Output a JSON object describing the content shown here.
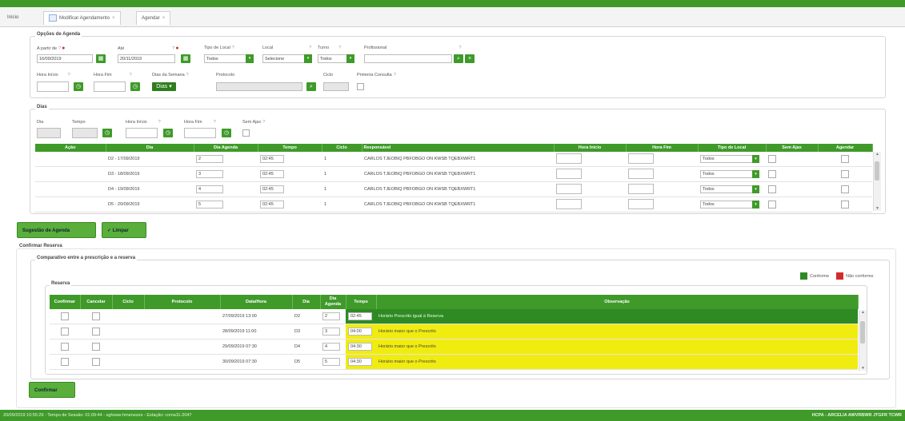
{
  "tabs": [
    {
      "label": "Início"
    },
    {
      "label": "Modificar Agendamento"
    },
    {
      "label": "Agendar"
    }
  ],
  "opcoes": {
    "legend": "Opções de Agenda",
    "a_partir_de": {
      "label": "A partir de",
      "value": "16/09/2019"
    },
    "ate": {
      "label": "Até",
      "value": "20/11/2019"
    },
    "tipo_local": {
      "label": "Tipo de Local",
      "value": "Todos"
    },
    "local": {
      "label": "Local",
      "value": "Selecione"
    },
    "turno": {
      "label": "Turno",
      "value": "Todos"
    },
    "profissional": {
      "label": "Profissional",
      "value": ""
    },
    "hora_inicio": {
      "label": "Hora Início"
    },
    "hora_fim": {
      "label": "Hora Fim"
    },
    "dias_semana": {
      "label": "Dias da Semana",
      "btn": "Dias"
    },
    "protocolo": {
      "label": "Protocolo"
    },
    "ciclo": {
      "label": "Ciclo"
    },
    "primeira_consulta": {
      "label": "Primeira Consulta"
    }
  },
  "dias": {
    "legend": "Dias",
    "labels": {
      "dia": "Dia",
      "tempo": "Tempo",
      "hora_inicio": "Hora Início",
      "hora_fim": "Hora Fim",
      "sem_ajax": "Sem Ajax"
    },
    "columns": [
      "Ação",
      "Dia",
      "Dia Agenda",
      "Tempo",
      "Ciclo",
      "Responsável",
      "Hora Início",
      "Hora Fim",
      "Tipo de Local",
      "Sem Ajax",
      "Agendar"
    ],
    "rows": [
      {
        "dia": "D2 - 17/09/2019",
        "dia_agenda": "2",
        "tempo": "02:45",
        "ciclo": "1",
        "responsavel": "CARLOS TJEOBIQ PBFOBGO ON KWSB TQEBXWRT1",
        "tipo": "Todos"
      },
      {
        "dia": "D3 - 18/09/2019",
        "dia_agenda": "3",
        "tempo": "02:45",
        "ciclo": "1",
        "responsavel": "CARLOS TJEOBIQ PBFOBGO ON KWSB TQEBXWRT1",
        "tipo": "Todos"
      },
      {
        "dia": "D4 - 19/09/2019",
        "dia_agenda": "4",
        "tempo": "02:45",
        "ciclo": "1",
        "responsavel": "CARLOS TJEOBIQ PBFOBGO ON KWSB TQEBXWRT1",
        "tipo": "Todos"
      },
      {
        "dia": "D5 - 20/09/2019",
        "dia_agenda": "5",
        "tempo": "02:45",
        "ciclo": "1",
        "responsavel": "CARLOS TJEOBIQ PBFOBGO ON KWSB TQEBXWRT1",
        "tipo": "Todos"
      }
    ]
  },
  "buttons": {
    "sugestao": "Sugestão de Agenda",
    "limpar": "Limpar",
    "confirmar": "Confirmar"
  },
  "confirmar_reserva": {
    "legend": "Confirmar Reserva",
    "comparativo": "Comparativo entre a prescrição e a reserva",
    "legend_conforme": "Conforme",
    "legend_nao_conforme": "Não conforme",
    "colors": {
      "conforme": "#2f8a24",
      "nao_conforme": "#d22b2b",
      "warn": "#f1ec10"
    }
  },
  "reserva": {
    "legend": "Reserva",
    "columns": [
      "Confirmar",
      "Cancelar",
      "Ciclo",
      "Protocolo",
      "Data/Hora",
      "Dia",
      "Dia Agenda",
      "Tempo",
      "Observação"
    ],
    "rows": [
      {
        "datahora": "27/09/2019 13:00",
        "dia": "D2",
        "dia_agenda": "2",
        "tempo": "02:45",
        "obs": "Horário Prescrito igual à Reserva",
        "status": "g"
      },
      {
        "datahora": "28/09/2019 11:00",
        "dia": "D3",
        "dia_agenda": "3",
        "tempo": "04:00",
        "obs": "Horário maior que o Prescrito",
        "status": "y"
      },
      {
        "datahora": "29/09/2019 07:30",
        "dia": "D4",
        "dia_agenda": "4",
        "tempo": "04:30",
        "obs": "Horário maior que o Prescrito",
        "status": "y"
      },
      {
        "datahora": "30/09/2019 07:30",
        "dia": "D5",
        "dia_agenda": "5",
        "tempo": "04:30",
        "obs": "Horário maior que o Prescrito",
        "status": "y"
      }
    ]
  },
  "status": {
    "left": "20/09/2019 10:55:29 - Tempo de Sessão: 01:09:44 - sghosw-hmenezes - Estação: coma11-2047",
    "right": "HCPA - ARCELIA AWVRBWR JTGFR TCWR"
  }
}
